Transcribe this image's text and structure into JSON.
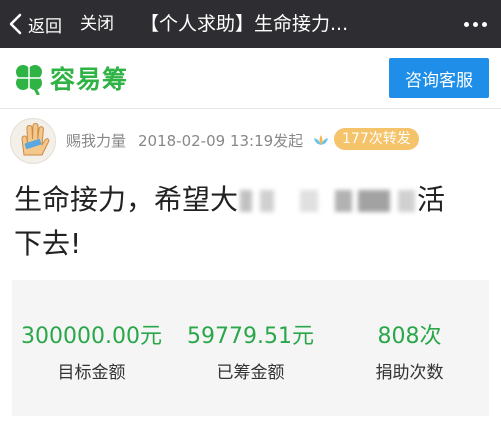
{
  "navbar": {
    "back_label": "返回",
    "close_label": "关闭",
    "title": "【个人求助】生命接力..."
  },
  "brand": {
    "logo_text": "容易筹",
    "consult_button": "咨询客服",
    "brand_color": "#2fb345",
    "button_color": "#1e8ee8"
  },
  "post": {
    "author": "赐我力量",
    "time": "2018-02-09 13:19发起",
    "share_badge": "177次转发",
    "title_start": "生命接力，希望大",
    "title_end": "活",
    "title_line2": "下去!"
  },
  "stats": [
    {
      "value": "300000.00元",
      "label": "目标金额"
    },
    {
      "value": "59779.51元",
      "label": "已筹金额"
    },
    {
      "value": "808次",
      "label": "捐助次数"
    }
  ]
}
